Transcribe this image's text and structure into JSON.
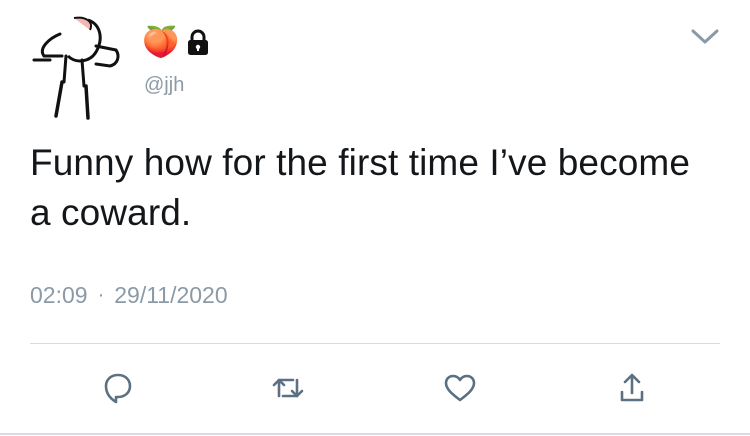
{
  "tweet": {
    "account": {
      "emoji": "🍑",
      "badge_icon": "lock-icon",
      "handle": "@jjh"
    },
    "text": "Funny how for the first time I’ve become a coward.",
    "time": "02:09",
    "separator": "·",
    "date": "29/11/2020",
    "actions": [
      {
        "name": "reply",
        "icon": "reply-icon"
      },
      {
        "name": "retweet",
        "icon": "retweet-icon"
      },
      {
        "name": "like",
        "icon": "heart-icon"
      },
      {
        "name": "share",
        "icon": "share-icon"
      }
    ],
    "colors": {
      "text": "#14171a",
      "secondary": "#8b9aa7",
      "icon": "#5b7083",
      "divider": "#d7dde2"
    }
  }
}
